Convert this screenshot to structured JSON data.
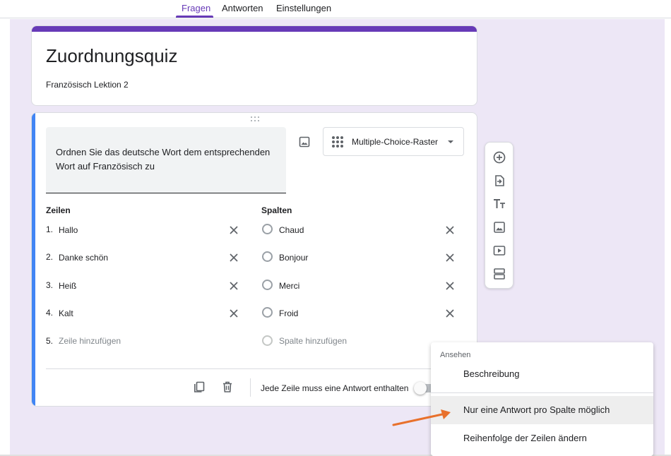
{
  "tabs": [
    {
      "label": "Fragen",
      "active": true
    },
    {
      "label": "Antworten",
      "active": false
    },
    {
      "label": "Einstellungen",
      "active": false
    }
  ],
  "colors": {
    "accent": "#673ab7",
    "question_accent": "#4285f4",
    "background": "#ede7f6",
    "arrow": "#e8712c"
  },
  "form": {
    "title": "Zuordnungsquiz",
    "description": "Französisch Lektion 2"
  },
  "question": {
    "text": "Ordnen Sie das deutsche Wort dem entsprechenden Wort auf Französisch zu",
    "type_label": "Multiple-Choice-Raster",
    "rows_header": "Zeilen",
    "columns_header": "Spalten",
    "rows": [
      {
        "num": "1.",
        "label": "Hallo"
      },
      {
        "num": "2.",
        "label": "Danke schön"
      },
      {
        "num": "3.",
        "label": "Heiß"
      },
      {
        "num": "4.",
        "label": "Kalt"
      }
    ],
    "add_row": {
      "num": "5.",
      "label": "Zeile hinzufügen"
    },
    "columns": [
      "Chaud",
      "Bonjour",
      "Merci",
      "Froid"
    ],
    "add_column": "Spalte hinzufügen",
    "required_label": "Jede Zeile muss eine Antwort enthalten",
    "required_on": false
  },
  "toolbar_icons": [
    "add-question-icon",
    "import-questions-icon",
    "add-title-icon",
    "add-image-icon",
    "add-video-icon",
    "add-section-icon"
  ],
  "menu": {
    "header": "Ansehen",
    "items": [
      {
        "label": "Beschreibung",
        "highlighted": false
      },
      {
        "label": "Nur eine Antwort pro Spalte möglich",
        "highlighted": true
      },
      {
        "label": "Reihenfolge der Zeilen ändern",
        "highlighted": false
      }
    ]
  }
}
